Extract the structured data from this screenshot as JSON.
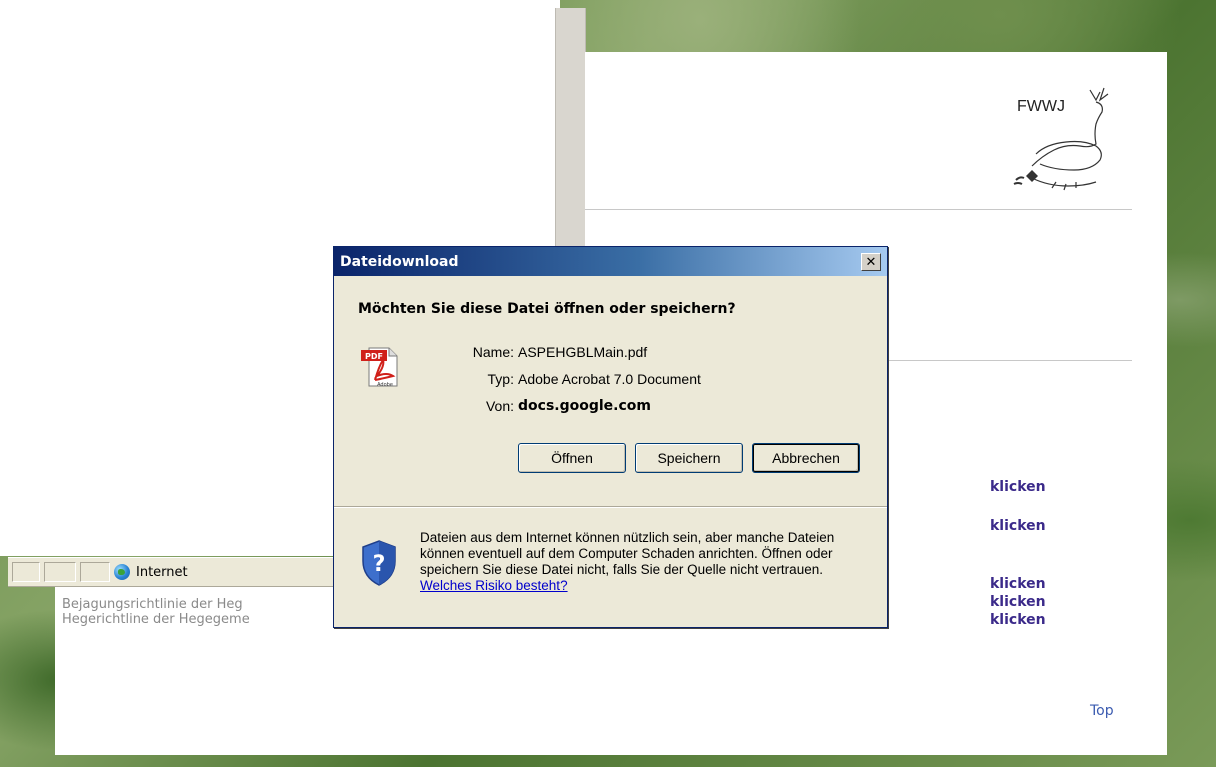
{
  "dialog": {
    "title": "Dateidownload",
    "close_label": "✕",
    "question": "Möchten Sie diese Datei öffnen oder speichern?",
    "file_info": {
      "name_label": "Name:",
      "name_value": "ASPEHGBLMain.pdf",
      "type_label": "Typ:",
      "type_value": "Adobe Acrobat 7.0 Document",
      "source_label": "Von:",
      "source_value": "docs.google.com"
    },
    "buttons": {
      "open": "Öffnen",
      "save": "Speichern",
      "cancel": "Abbrechen"
    },
    "warning_text": "Dateien aus dem Internet können nützlich sein, aber manche Dateien können eventuell auf dem Computer Schaden anrichten. Öffnen oder speichern Sie diese Datei nicht, falls Sie der Quelle nicht vertrauen.",
    "risk_link": "Welches Risiko besteht?",
    "pdf_icon_text": "PDF",
    "pdf_icon_brand": "Adobe"
  },
  "status_bar": {
    "zone_label": "Internet"
  },
  "page": {
    "lower_links": [
      "Bejagungsrichtlinie der Heg",
      "Hegerichtline der Hegegeme"
    ],
    "logo_text": "FWWJ",
    "klicken_links": [
      "klicken",
      "klicken",
      "klicken",
      "klicken",
      "klicken"
    ],
    "top_link": "Top"
  },
  "colors": {
    "titlebar_start": "#0a246a",
    "titlebar_end": "#a6caf0",
    "dialog_bg": "#ece9d8",
    "link_blue": "#0000cc",
    "klicken_purple": "#3b2a8a"
  }
}
